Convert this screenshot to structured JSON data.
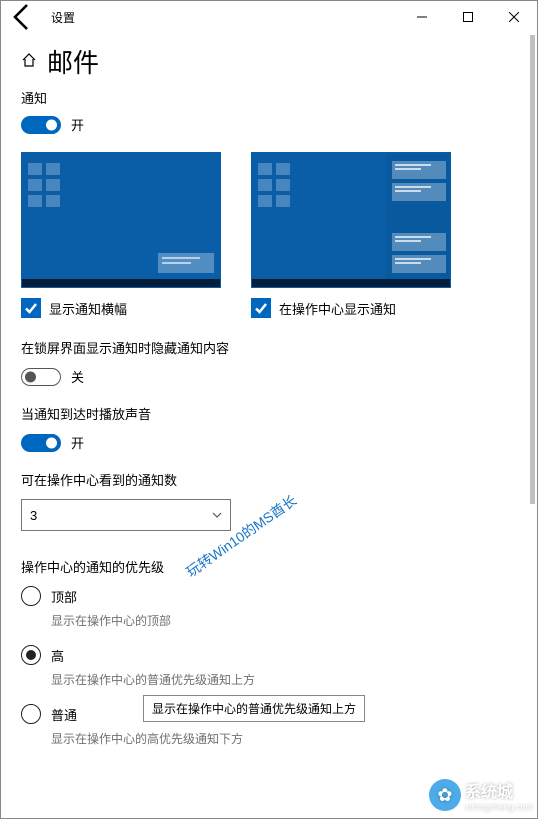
{
  "window": {
    "title": "设置"
  },
  "header": {
    "page_title": "邮件"
  },
  "notifications": {
    "label": "通知",
    "toggle_on_label": "开"
  },
  "preview": {
    "banner_checkbox_label": "显示通知横幅",
    "action_center_checkbox_label": "在操作中心显示通知"
  },
  "lockscreen": {
    "title": "在锁屏界面显示通知时隐藏通知内容",
    "toggle_off_label": "关"
  },
  "sound": {
    "title": "当通知到达时播放声音",
    "toggle_on_label": "开"
  },
  "visible_count": {
    "title": "可在操作中心看到的通知数",
    "value": "3"
  },
  "priority": {
    "title": "操作中心的通知的优先级",
    "options": [
      {
        "label": "顶部",
        "desc": "显示在操作中心的顶部",
        "selected": false
      },
      {
        "label": "高",
        "desc": "显示在操作中心的普通优先级通知上方",
        "selected": true
      },
      {
        "label": "普通",
        "desc": "显示在操作中心的高优先级通知下方",
        "selected": false
      }
    ]
  },
  "tooltip": {
    "text": "显示在操作中心的普通优先级通知上方"
  },
  "watermark": {
    "diagonal": "玩转Win10的MS酋长",
    "site": "系统城",
    "site_url": "xitongcheng.com"
  }
}
